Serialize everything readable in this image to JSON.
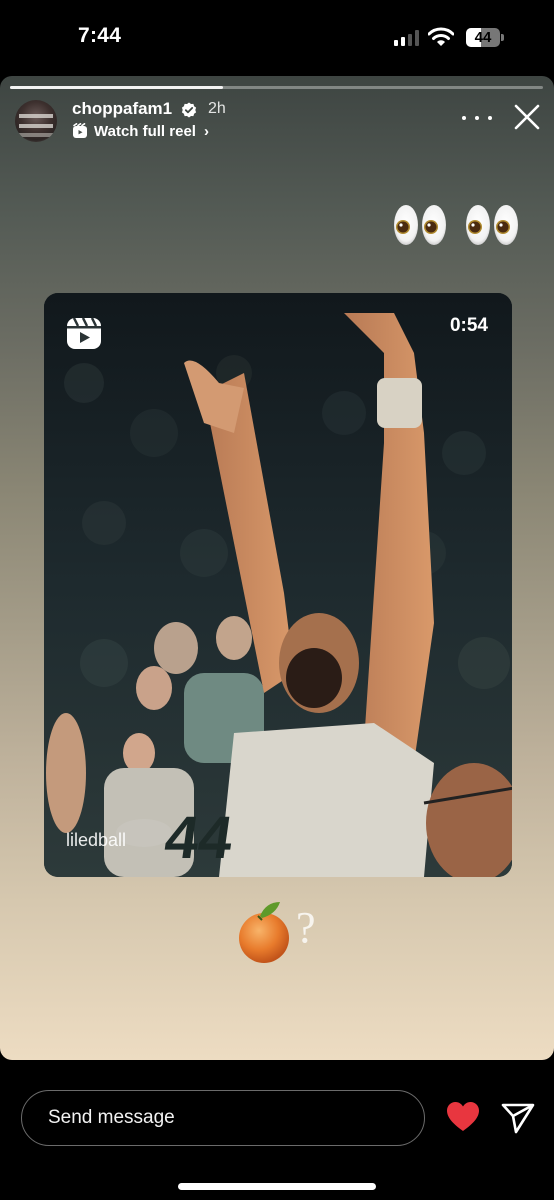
{
  "status_bar": {
    "time": "7:44",
    "battery_level": "44",
    "battery_percent": 44,
    "signal_bars_active": 2,
    "signal_bars_total": 4
  },
  "story": {
    "progress_fraction": 0.4,
    "username": "choppafam1",
    "verified": true,
    "timestamp": "2h",
    "reel_link_label": "Watch full reel",
    "reel_link_chevron": "›",
    "icons": {
      "more": "more-horizontal-icon",
      "close": "close-icon",
      "verified": "verified-badge-icon",
      "reel": "reels-icon"
    },
    "eyes_emoji": "👀 👀",
    "reel_card": {
      "duration": "0:54",
      "author": "liledball",
      "jersey_number": "44"
    },
    "sticker": {
      "emoji": "🍊",
      "text": "?"
    }
  },
  "footer": {
    "message_placeholder": "Send message",
    "heart_color": "#e8363f",
    "icons": {
      "like": "heart-icon",
      "share": "send-icon"
    }
  }
}
